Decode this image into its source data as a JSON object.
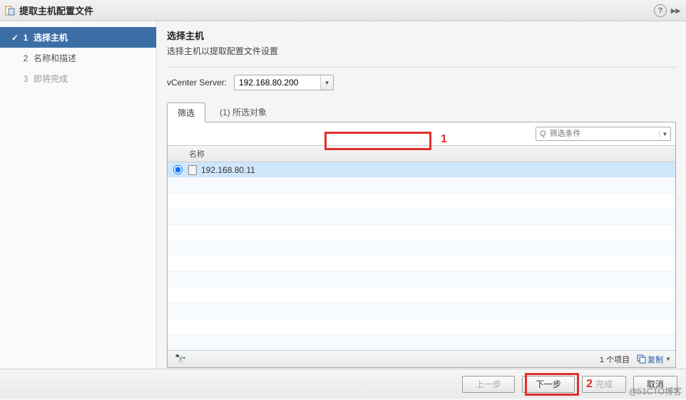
{
  "titlebar": {
    "title": "提取主机配置文件"
  },
  "steps": [
    {
      "num": "1",
      "label": "选择主机",
      "state": "active"
    },
    {
      "num": "2",
      "label": "名称和描述",
      "state": "normal"
    },
    {
      "num": "3",
      "label": "即将完成",
      "state": "future"
    }
  ],
  "main": {
    "heading": "选择主机",
    "subheading": "选择主机以提取配置文件设置",
    "vcenter_label": "vCenter Server:",
    "vcenter_value": "192.168.80.200"
  },
  "tabs": {
    "filter": "筛选",
    "selected": "(1) 所选对象"
  },
  "filter_placeholder": "筛选条件",
  "column_name": "名称",
  "rows": [
    {
      "ip": "192.168.80.11",
      "selected": true
    }
  ],
  "footer": {
    "count": "1 个项目",
    "copy": "复制"
  },
  "buttons": {
    "back": "上一步",
    "next": "下一步",
    "finish": "完成",
    "cancel": "取消"
  },
  "annotations": {
    "a1": "1",
    "a2": "2"
  },
  "watermark": "@51CTO博客"
}
